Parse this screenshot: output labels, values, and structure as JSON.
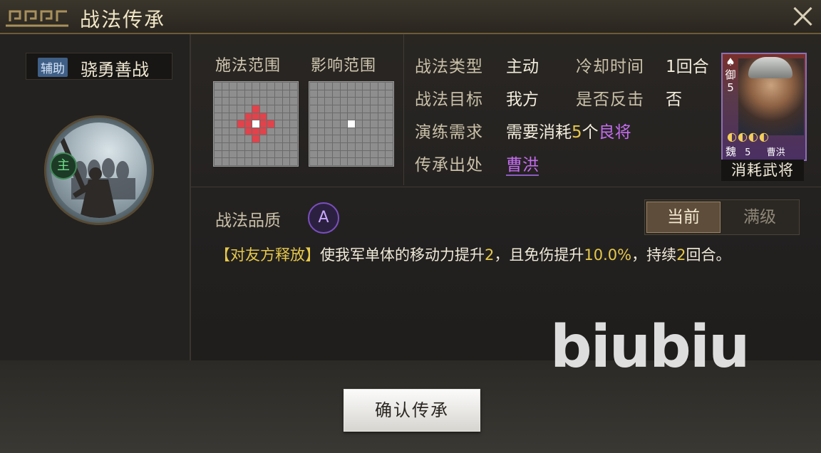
{
  "window": {
    "title": "战法传承"
  },
  "skill": {
    "tag": "辅助",
    "name": "骁勇善战",
    "badge": "主"
  },
  "grids": {
    "cast_label": "施法范围",
    "effect_label": "影响范围"
  },
  "info": {
    "type_label": "战法类型",
    "type_value": "主动",
    "cooldown_label": "冷却时间",
    "cooldown_value": "1回合",
    "target_label": "战法目标",
    "target_value": "我方",
    "counter_label": "是否反击",
    "counter_value": "否",
    "require_label": "演练需求",
    "require_prefix": "需要消耗",
    "require_count": "5",
    "require_unit": "个",
    "require_grade": "良将",
    "source_label": "传承出处",
    "source_value": "曹洪"
  },
  "hero_card": {
    "side_top": "御",
    "side_num": "5",
    "stars": "◐◐◐◐",
    "faction": "魏",
    "cost": "5",
    "name": "曹洪",
    "caption": "消耗武将"
  },
  "quality": {
    "label": "战法品质",
    "grade": "A"
  },
  "toggle": {
    "current": "当前",
    "max": "满级"
  },
  "description": {
    "tag": "【对友方释放】",
    "p1": "使我军单体的移动力提升",
    "v1": "2",
    "p2": "，且免伤提升",
    "v2": "10.0%",
    "p3": "，持续",
    "v3": "2",
    "p4": "回合。"
  },
  "watermark": "biubiu",
  "confirm_button": "确认传承"
}
